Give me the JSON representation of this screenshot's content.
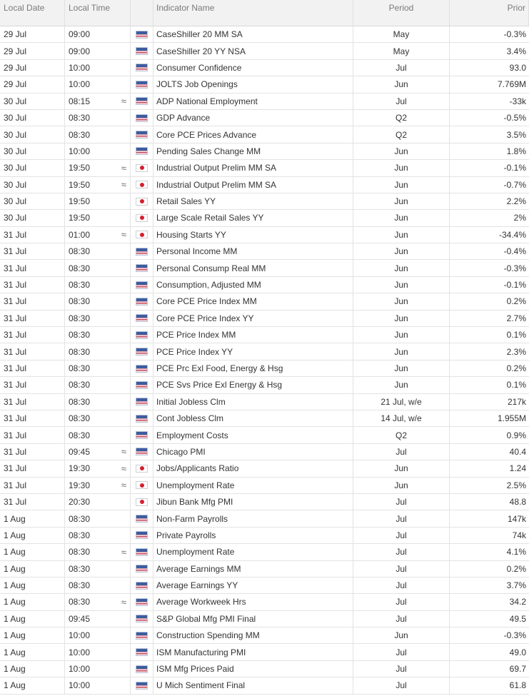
{
  "headers": {
    "date": "Local Date",
    "time": "Local Time",
    "name": "Indicator Name",
    "period": "Period",
    "prior": "Prior"
  },
  "rows": [
    {
      "date": "29 Jul",
      "time": "09:00",
      "vol": "",
      "flag": "us",
      "name": "CaseShiller 20 MM SA",
      "period": "May",
      "prior": "-0.3%"
    },
    {
      "date": "29 Jul",
      "time": "09:00",
      "vol": "",
      "flag": "us",
      "name": "CaseShiller 20 YY NSA",
      "period": "May",
      "prior": "3.4%"
    },
    {
      "date": "29 Jul",
      "time": "10:00",
      "vol": "",
      "flag": "us",
      "name": "Consumer Confidence",
      "period": "Jul",
      "prior": "93.0"
    },
    {
      "date": "29 Jul",
      "time": "10:00",
      "vol": "",
      "flag": "us",
      "name": "JOLTS Job Openings",
      "period": "Jun",
      "prior": "7.769M"
    },
    {
      "date": "30 Jul",
      "time": "08:15",
      "vol": "≈",
      "flag": "us",
      "name": "ADP National Employment",
      "period": "Jul",
      "prior": "-33k"
    },
    {
      "date": "30 Jul",
      "time": "08:30",
      "vol": "",
      "flag": "us",
      "name": "GDP Advance",
      "period": "Q2",
      "prior": "-0.5%"
    },
    {
      "date": "30 Jul",
      "time": "08:30",
      "vol": "",
      "flag": "us",
      "name": "Core PCE Prices Advance",
      "period": "Q2",
      "prior": "3.5%"
    },
    {
      "date": "30 Jul",
      "time": "10:00",
      "vol": "",
      "flag": "us",
      "name": "Pending Sales Change MM",
      "period": "Jun",
      "prior": "1.8%"
    },
    {
      "date": "30 Jul",
      "time": "19:50",
      "vol": "≈",
      "flag": "jp",
      "name": "Industrial Output Prelim MM SA",
      "period": "Jun",
      "prior": "-0.1%"
    },
    {
      "date": "30 Jul",
      "time": "19:50",
      "vol": "≈",
      "flag": "jp",
      "name": "Industrial Output Prelim MM SA",
      "period": "Jun",
      "prior": "-0.7%"
    },
    {
      "date": "30 Jul",
      "time": "19:50",
      "vol": "",
      "flag": "jp",
      "name": "Retail Sales YY",
      "period": "Jun",
      "prior": "2.2%"
    },
    {
      "date": "30 Jul",
      "time": "19:50",
      "vol": "",
      "flag": "jp",
      "name": "Large Scale Retail Sales YY",
      "period": "Jun",
      "prior": "2%"
    },
    {
      "date": "31 Jul",
      "time": "01:00",
      "vol": "≈",
      "flag": "jp",
      "name": "Housing Starts YY",
      "period": "Jun",
      "prior": "-34.4%"
    },
    {
      "date": "31 Jul",
      "time": "08:30",
      "vol": "",
      "flag": "us",
      "name": "Personal Income MM",
      "period": "Jun",
      "prior": "-0.4%"
    },
    {
      "date": "31 Jul",
      "time": "08:30",
      "vol": "",
      "flag": "us",
      "name": "Personal Consump Real MM",
      "period": "Jun",
      "prior": "-0.3%"
    },
    {
      "date": "31 Jul",
      "time": "08:30",
      "vol": "",
      "flag": "us",
      "name": "Consumption, Adjusted MM",
      "period": "Jun",
      "prior": "-0.1%"
    },
    {
      "date": "31 Jul",
      "time": "08:30",
      "vol": "",
      "flag": "us",
      "name": "Core PCE Price Index MM",
      "period": "Jun",
      "prior": "0.2%"
    },
    {
      "date": "31 Jul",
      "time": "08:30",
      "vol": "",
      "flag": "us",
      "name": "Core PCE Price Index YY",
      "period": "Jun",
      "prior": "2.7%"
    },
    {
      "date": "31 Jul",
      "time": "08:30",
      "vol": "",
      "flag": "us",
      "name": "PCE Price Index MM",
      "period": "Jun",
      "prior": "0.1%"
    },
    {
      "date": "31 Jul",
      "time": "08:30",
      "vol": "",
      "flag": "us",
      "name": "PCE Price Index YY",
      "period": "Jun",
      "prior": "2.3%"
    },
    {
      "date": "31 Jul",
      "time": "08:30",
      "vol": "",
      "flag": "us",
      "name": "PCE Prc Exl Food, Energy & Hsg",
      "period": "Jun",
      "prior": "0.2%"
    },
    {
      "date": "31 Jul",
      "time": "08:30",
      "vol": "",
      "flag": "us",
      "name": "PCE Svs Price Exl Energy & Hsg",
      "period": "Jun",
      "prior": "0.1%"
    },
    {
      "date": "31 Jul",
      "time": "08:30",
      "vol": "",
      "flag": "us",
      "name": "Initial Jobless Clm",
      "period": "21 Jul, w/e",
      "prior": "217k"
    },
    {
      "date": "31 Jul",
      "time": "08:30",
      "vol": "",
      "flag": "us",
      "name": "Cont Jobless Clm",
      "period": "14 Jul, w/e",
      "prior": "1.955M"
    },
    {
      "date": "31 Jul",
      "time": "08:30",
      "vol": "",
      "flag": "us",
      "name": "Employment Costs",
      "period": "Q2",
      "prior": "0.9%"
    },
    {
      "date": "31 Jul",
      "time": "09:45",
      "vol": "≈",
      "flag": "us",
      "name": "Chicago PMI",
      "period": "Jul",
      "prior": "40.4"
    },
    {
      "date": "31 Jul",
      "time": "19:30",
      "vol": "≈",
      "flag": "jp",
      "name": "Jobs/Applicants Ratio",
      "period": "Jun",
      "prior": "1.24"
    },
    {
      "date": "31 Jul",
      "time": "19:30",
      "vol": "≈",
      "flag": "jp",
      "name": "Unemployment Rate",
      "period": "Jun",
      "prior": "2.5%"
    },
    {
      "date": "31 Jul",
      "time": "20:30",
      "vol": "",
      "flag": "jp",
      "name": "Jibun Bank Mfg PMI",
      "period": "Jul",
      "prior": "48.8"
    },
    {
      "date": "1 Aug",
      "time": "08:30",
      "vol": "",
      "flag": "us",
      "name": "Non-Farm Payrolls",
      "period": "Jul",
      "prior": "147k"
    },
    {
      "date": "1 Aug",
      "time": "08:30",
      "vol": "",
      "flag": "us",
      "name": "Private Payrolls",
      "period": "Jul",
      "prior": "74k"
    },
    {
      "date": "1 Aug",
      "time": "08:30",
      "vol": "≈",
      "flag": "us",
      "name": "Unemployment Rate",
      "period": "Jul",
      "prior": "4.1%"
    },
    {
      "date": "1 Aug",
      "time": "08:30",
      "vol": "",
      "flag": "us",
      "name": "Average Earnings MM",
      "period": "Jul",
      "prior": "0.2%"
    },
    {
      "date": "1 Aug",
      "time": "08:30",
      "vol": "",
      "flag": "us",
      "name": "Average Earnings YY",
      "period": "Jul",
      "prior": "3.7%"
    },
    {
      "date": "1 Aug",
      "time": "08:30",
      "vol": "≈",
      "flag": "us",
      "name": "Average Workweek Hrs",
      "period": "Jul",
      "prior": "34.2"
    },
    {
      "date": "1 Aug",
      "time": "09:45",
      "vol": "",
      "flag": "us",
      "name": "S&P Global Mfg PMI Final",
      "period": "Jul",
      "prior": "49.5"
    },
    {
      "date": "1 Aug",
      "time": "10:00",
      "vol": "",
      "flag": "us",
      "name": "Construction Spending MM",
      "period": "Jun",
      "prior": "-0.3%"
    },
    {
      "date": "1 Aug",
      "time": "10:00",
      "vol": "",
      "flag": "us",
      "name": "ISM Manufacturing PMI",
      "period": "Jul",
      "prior": "49.0"
    },
    {
      "date": "1 Aug",
      "time": "10:00",
      "vol": "",
      "flag": "us",
      "name": "ISM Mfg Prices Paid",
      "period": "Jul",
      "prior": "69.7"
    },
    {
      "date": "1 Aug",
      "time": "10:00",
      "vol": "",
      "flag": "us",
      "name": "U Mich Sentiment Final",
      "period": "Jul",
      "prior": "61.8"
    }
  ]
}
